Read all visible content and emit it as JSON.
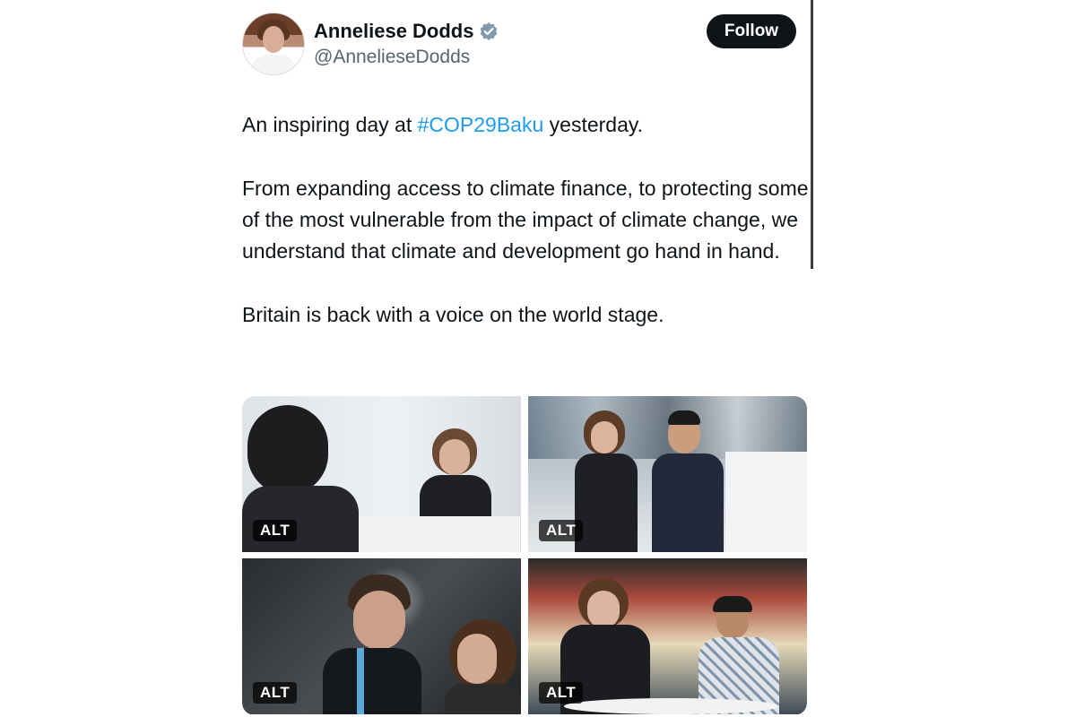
{
  "author": {
    "display_name": "Anneliese Dodds",
    "handle": "@AnnelieseDodds"
  },
  "follow_label": "Follow",
  "tweet": {
    "line1_prefix": "An inspiring day at ",
    "hashtag": "#COP29Baku",
    "line1_suffix": " yesterday.",
    "paragraph2": "From expanding access to climate finance, to protecting some of the most vulnerable from the impact of climate change, we understand that climate and development go hand in hand.",
    "paragraph3": "Britain is back with a voice on the world stage."
  },
  "media": [
    {
      "alt_label": "ALT"
    },
    {
      "alt_label": "ALT"
    },
    {
      "alt_label": "ALT"
    },
    {
      "alt_label": "ALT"
    }
  ],
  "colors": {
    "hashtag": "#1d9bf0",
    "verified_badge": "#829aab",
    "follow_button": "#0f1419"
  }
}
